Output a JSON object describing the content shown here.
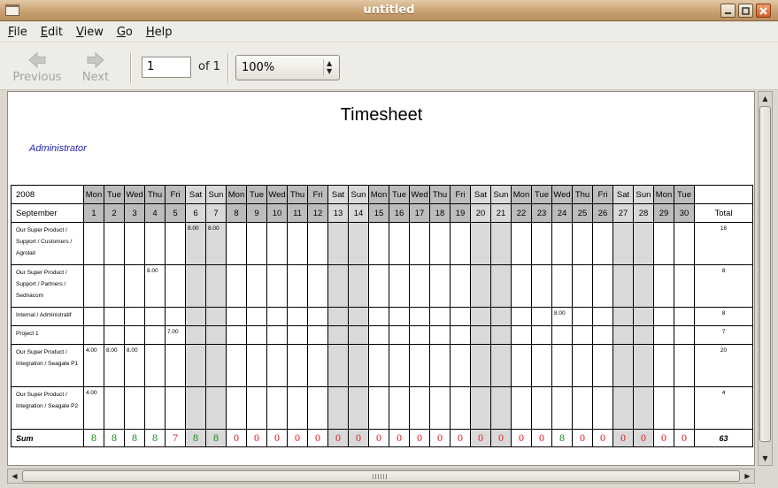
{
  "window": {
    "title": "untitled"
  },
  "menu": [
    {
      "key": "F",
      "rest": "ile"
    },
    {
      "key": "E",
      "rest": "dit"
    },
    {
      "key": "V",
      "rest": "iew"
    },
    {
      "key": "G",
      "rest": "o"
    },
    {
      "key": "H",
      "rest": "elp"
    }
  ],
  "toolbar": {
    "previous_label": "Previous",
    "next_label": "Next",
    "page_value": "1",
    "page_of": "of 1",
    "zoom_value": "100%"
  },
  "document": {
    "title": "Timesheet",
    "user": "Administrator",
    "year": "2008",
    "month": "September",
    "total_label": "Total",
    "sum_label": "Sum",
    "grand_total": "63",
    "weekdays": [
      "Mon",
      "Tue",
      "Wed",
      "Thu",
      "Fri",
      "Sat",
      "Sun",
      "Mon",
      "Tue",
      "Wed",
      "Thu",
      "Fri",
      "Sat",
      "Sun",
      "Mon",
      "Tue",
      "Wed",
      "Thu",
      "Fri",
      "Sat",
      "Sun",
      "Mon",
      "Tue",
      "Wed",
      "Thu",
      "Fri",
      "Sat",
      "Sun",
      "Mon",
      "Tue"
    ],
    "days": [
      "1",
      "2",
      "3",
      "4",
      "5",
      "6",
      "7",
      "8",
      "9",
      "10",
      "11",
      "12",
      "13",
      "14",
      "15",
      "16",
      "17",
      "18",
      "19",
      "20",
      "21",
      "22",
      "23",
      "24",
      "25",
      "26",
      "27",
      "28",
      "29",
      "30"
    ],
    "weekend_day_indices": [
      5,
      6,
      12,
      13,
      19,
      20,
      26,
      27
    ],
    "rows": [
      {
        "label": "Our Super Product / Support / Customers / Agrolait",
        "cells": {
          "5": "8.00",
          "6": "8.00"
        },
        "total": "16"
      },
      {
        "label": "Our Super Product / Support / Partners / Sednacom",
        "cells": {
          "3": "8.00"
        },
        "total": "8"
      },
      {
        "label": "Internal / Administratif",
        "cells": {
          "23": "8.00"
        },
        "total": "8"
      },
      {
        "label": "Project 1",
        "cells": {
          "4": "7.00"
        },
        "total": "7"
      },
      {
        "label": "Our Super Product / Integration / Seagate P1",
        "cells": {
          "0": "4.00",
          "1": "8.00",
          "2": "8.00"
        },
        "total": "20"
      },
      {
        "label": "Our Super Product / Integration / Seagate P2",
        "cells": {
          "0": "4.00"
        },
        "total": "4"
      }
    ],
    "sums": [
      "8",
      "8",
      "8",
      "8",
      "7",
      "8",
      "8",
      "0",
      "0",
      "0",
      "0",
      "0",
      "0",
      "0",
      "0",
      "0",
      "0",
      "0",
      "0",
      "0",
      "0",
      "0",
      "0",
      "8",
      "0",
      "0",
      "0",
      "0",
      "0",
      "0"
    ]
  },
  "colors": {
    "sum_met": "#1a8a1a",
    "sum_short": "#e02020",
    "weekend_cell": "#d9d9d9",
    "weekday_header": "#bcbcbc",
    "user_text": "#2424b8"
  },
  "icons": {
    "previous": "arrow-left-icon",
    "next": "arrow-right-icon",
    "zoom": "spin-arrows-icon",
    "close": "close-icon",
    "maximize": "maximize-icon",
    "minimize": "minimize-icon"
  }
}
